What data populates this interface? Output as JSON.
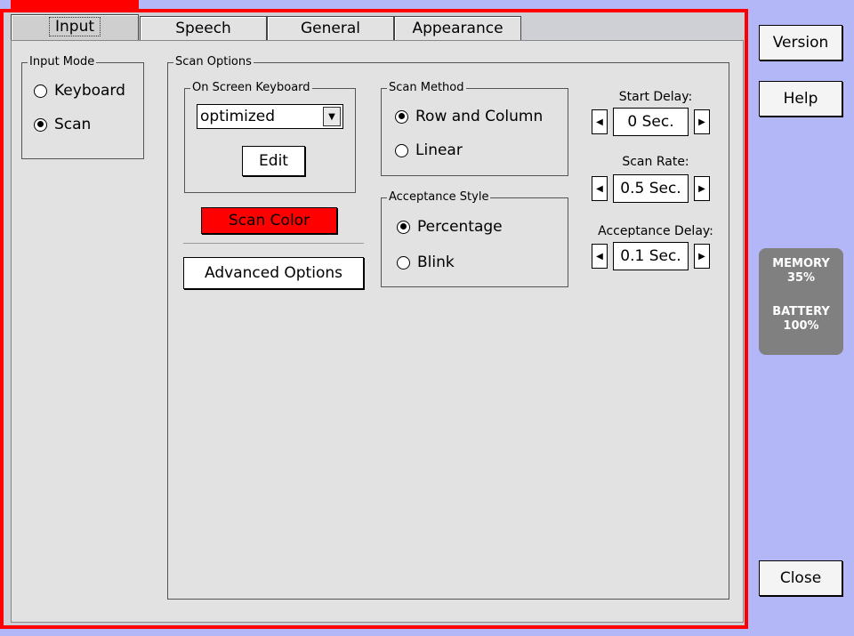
{
  "tabs": [
    {
      "label": "Input",
      "active": true
    },
    {
      "label": "Speech",
      "active": false
    },
    {
      "label": "General",
      "active": false
    },
    {
      "label": "Appearance",
      "active": false
    }
  ],
  "input_mode": {
    "legend": "Input Mode",
    "options": [
      {
        "label": "Keyboard",
        "checked": false
      },
      {
        "label": "Scan",
        "checked": true
      }
    ]
  },
  "scan_options": {
    "legend": "Scan Options",
    "on_screen_keyboard": {
      "legend": "On Screen Keyboard",
      "selected": "optimized",
      "edit_label": "Edit"
    },
    "scan_color_label": "Scan Color",
    "advanced_options_label": "Advanced Options",
    "scan_method": {
      "legend": "Scan Method",
      "options": [
        {
          "label": "Row and Column",
          "checked": true
        },
        {
          "label": "Linear",
          "checked": false
        }
      ]
    },
    "acceptance_style": {
      "legend": "Acceptance Style",
      "options": [
        {
          "label": "Percentage",
          "checked": true
        },
        {
          "label": "Blink",
          "checked": false
        }
      ]
    },
    "start_delay": {
      "label": "Start Delay:",
      "value": "0 Sec."
    },
    "scan_rate": {
      "label": "Scan Rate:",
      "value": "0.5 Sec."
    },
    "acceptance_delay": {
      "label": "Acceptance Delay:",
      "value": "0.1 Sec."
    }
  },
  "side": {
    "version_label": "Version",
    "help_label": "Help",
    "close_label": "Close",
    "memory_label": "MEMORY",
    "memory_value": "35%",
    "battery_label": "BATTERY",
    "battery_value": "100%"
  },
  "colors": {
    "accent_red": "#ff0000",
    "background": "#b3b7f7",
    "status_panel": "#808080"
  }
}
